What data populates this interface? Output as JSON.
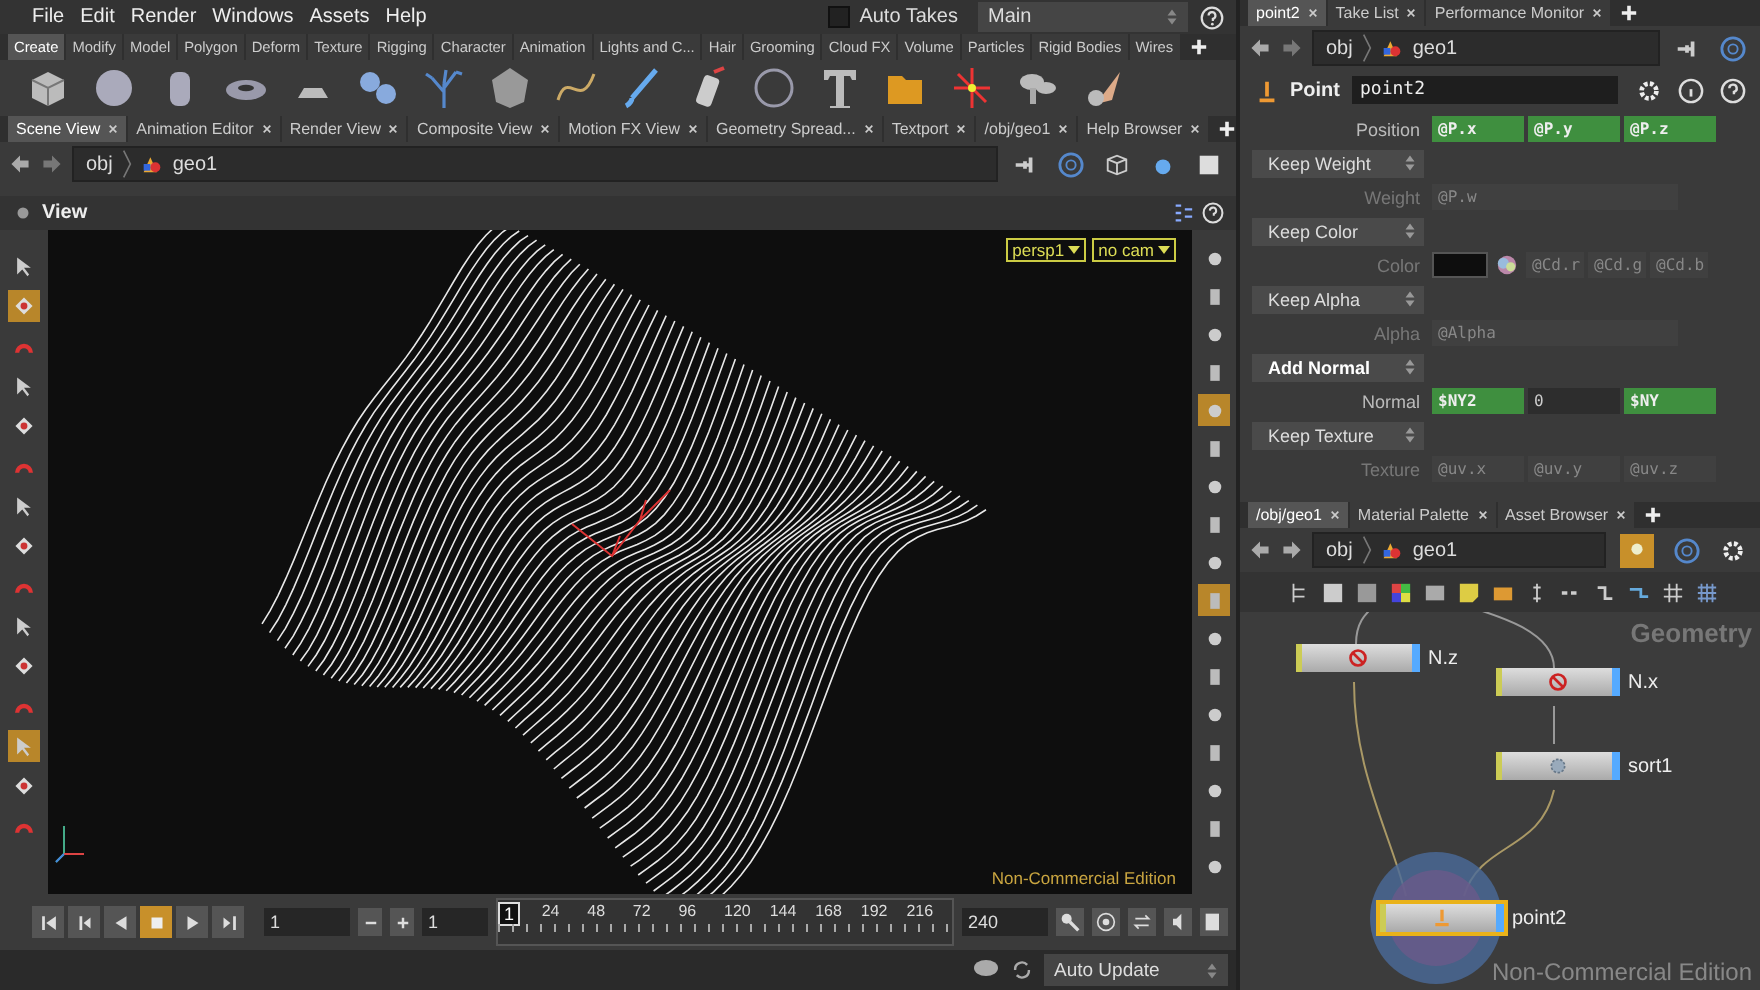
{
  "menubar": {
    "items": [
      "File",
      "Edit",
      "Render",
      "Windows",
      "Assets",
      "Help"
    ],
    "auto_takes": {
      "label": "Auto Takes",
      "checked": false
    },
    "desktop": "Main"
  },
  "shelf_tabs": [
    {
      "label": "Create",
      "selected": true
    },
    {
      "label": "Modify",
      "selected": false
    },
    {
      "label": "Model",
      "selected": false
    },
    {
      "label": "Polygon",
      "selected": false
    },
    {
      "label": "Deform",
      "selected": false
    },
    {
      "label": "Texture",
      "selected": false
    },
    {
      "label": "Rigging",
      "selected": false
    },
    {
      "label": "Character",
      "selected": false
    },
    {
      "label": "Animation",
      "selected": false
    },
    {
      "label": "Lights and C...",
      "selected": false
    },
    {
      "label": "Hair",
      "selected": false
    },
    {
      "label": "Grooming",
      "selected": false
    },
    {
      "label": "Cloud FX",
      "selected": false
    },
    {
      "label": "Volume",
      "selected": false
    },
    {
      "label": "Particles",
      "selected": false
    },
    {
      "label": "Rigid Bodies",
      "selected": false
    },
    {
      "label": "Wires",
      "selected": false
    }
  ],
  "pane_tabs": [
    {
      "label": "Scene View",
      "selected": true
    },
    {
      "label": "Animation Editor",
      "selected": false
    },
    {
      "label": "Render View",
      "selected": false
    },
    {
      "label": "Composite View",
      "selected": false
    },
    {
      "label": "Motion FX View",
      "selected": false
    },
    {
      "label": "Geometry Spread...",
      "selected": false
    },
    {
      "label": "Textport",
      "selected": false
    },
    {
      "label": "/obj/geo1",
      "selected": false
    },
    {
      "label": "Help Browser",
      "selected": false
    }
  ],
  "scene_path": [
    "obj",
    "geo1"
  ],
  "view_title": "View",
  "viewport": {
    "camera": "persp1",
    "cam_menu": "no cam",
    "edition": "Non-Commercial Edition"
  },
  "left_tools": [
    {
      "selected": false
    },
    {
      "selected": true
    },
    {
      "selected": false
    },
    {
      "selected": false
    },
    {
      "selected": false
    },
    {
      "selected": false
    },
    {
      "selected": false
    },
    {
      "selected": false
    },
    {
      "selected": false
    },
    {
      "selected": false
    },
    {
      "selected": false
    },
    {
      "selected": false
    },
    {
      "selected": true
    },
    {
      "selected": false
    },
    {
      "selected": false
    }
  ],
  "right_tools": [
    {
      "selected": false
    },
    {
      "selected": false
    },
    {
      "selected": false
    },
    {
      "selected": false
    },
    {
      "selected": true
    },
    {
      "selected": false
    },
    {
      "selected": false
    },
    {
      "selected": false
    },
    {
      "selected": false
    },
    {
      "selected": true
    },
    {
      "selected": false
    },
    {
      "selected": false
    },
    {
      "selected": false
    },
    {
      "selected": false
    },
    {
      "selected": false
    },
    {
      "selected": false
    },
    {
      "selected": false
    }
  ],
  "timeline": {
    "frame": "1",
    "start": "1",
    "current": "1",
    "ruler": [
      "24",
      "48",
      "72",
      "96",
      "120",
      "144",
      "168",
      "192",
      "216"
    ],
    "end": "240",
    "transport": [
      {
        "kind": "first",
        "selected": false
      },
      {
        "kind": "prev-key",
        "selected": false
      },
      {
        "kind": "reverse",
        "selected": false
      },
      {
        "kind": "stop",
        "selected": true
      },
      {
        "kind": "play",
        "selected": false
      },
      {
        "kind": "next-key",
        "selected": false
      }
    ]
  },
  "status": {
    "update_mode": "Auto Update"
  },
  "parm_tabs": [
    {
      "label": "point2",
      "selected": true
    },
    {
      "label": "Take List",
      "selected": false
    },
    {
      "label": "Performance Monitor",
      "selected": false
    }
  ],
  "parm_path": [
    "obj",
    "geo1"
  ],
  "node_type": "Point",
  "node_name": "point2",
  "parms": [
    {
      "kind": "vector",
      "label": "Position",
      "values": [
        "@P.x",
        "@P.y",
        "@P.z"
      ],
      "expression": true,
      "disabled": false
    },
    {
      "kind": "menu",
      "value": "Keep Weight",
      "modified": false
    },
    {
      "kind": "scalar",
      "label": "Weight",
      "value": "@P.w",
      "disabled": true
    },
    {
      "kind": "menu",
      "value": "Keep Color",
      "modified": false
    },
    {
      "kind": "color",
      "label": "Color",
      "color": "#0e0e0e",
      "values": [
        "@Cd.r",
        "@Cd.g",
        "@Cd.b"
      ],
      "disabled": true
    },
    {
      "kind": "menu",
      "value": "Keep Alpha",
      "modified": false
    },
    {
      "kind": "scalar",
      "label": "Alpha",
      "value": "@Alpha",
      "disabled": true
    },
    {
      "kind": "menu",
      "value": "Add Normal",
      "modified": true
    },
    {
      "kind": "normal",
      "label": "Normal",
      "values": [
        {
          "text": "$NY2",
          "expression": true
        },
        {
          "text": "0",
          "expression": false
        },
        {
          "text": "$NY",
          "expression": true
        }
      ],
      "disabled": false
    },
    {
      "kind": "menu",
      "value": "Keep Texture",
      "modified": false
    },
    {
      "kind": "vector",
      "label": "Texture",
      "values": [
        "@uv.x",
        "@uv.y",
        "@uv.z"
      ],
      "expression": false,
      "disabled": true
    }
  ],
  "network_tabs": [
    {
      "label": "/obj/geo1",
      "selected": true
    },
    {
      "label": "Material Palette",
      "selected": false
    },
    {
      "label": "Asset Browser",
      "selected": false
    }
  ],
  "network_path": [
    "obj",
    "geo1"
  ],
  "network": {
    "context": "Geometry",
    "edition": "Non-Commercial Edition",
    "nodes": [
      {
        "name": "N.z",
        "kind": "delete",
        "selected": false
      },
      {
        "name": "N.x",
        "kind": "delete",
        "selected": false
      },
      {
        "name": "sort1",
        "kind": "sort",
        "selected": false
      },
      {
        "name": "point2",
        "kind": "point",
        "selected": true
      }
    ]
  }
}
